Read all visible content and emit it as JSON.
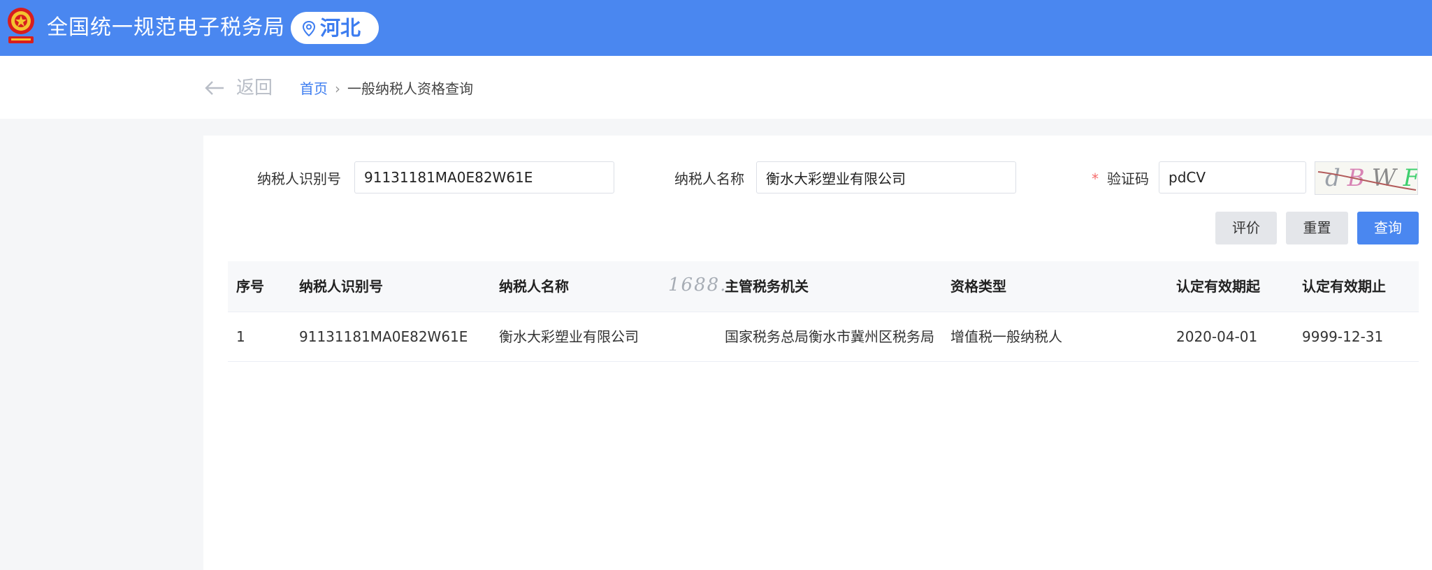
{
  "header": {
    "site_title": "全国统一规范电子税务局",
    "region": "河北",
    "brand_color": "#4a87f0"
  },
  "nav": {
    "back_label": "返回",
    "breadcrumb_home": "首页",
    "breadcrumb_separator": "›",
    "breadcrumb_current": "一般纳税人资格查询"
  },
  "form": {
    "taxpayer_id_label": "纳税人识别号",
    "taxpayer_id_value": "91131181MA0E82W61E",
    "taxpayer_name_label": "纳税人名称",
    "taxpayer_name_value": "衡水大彩塑业有限公司",
    "required_mark": "*",
    "captcha_label": "验证码",
    "captcha_value": "pdCV",
    "captcha_image_text": "dBWF"
  },
  "buttons": {
    "evaluate": "评价",
    "reset": "重置",
    "query": "查询"
  },
  "table": {
    "columns": [
      "序号",
      "纳税人识别号",
      "纳税人名称",
      "主管税务机关",
      "资格类型",
      "认定有效期起",
      "认定有效期止"
    ],
    "rows": [
      [
        "1",
        "91131181MA0E82W61E",
        "衡水大彩塑业有限公司",
        "国家税务总局衡水市冀州区税务局",
        "增值税一般纳税人",
        "2020-04-01",
        "9999-12-31"
      ]
    ]
  },
  "watermark": "1688."
}
